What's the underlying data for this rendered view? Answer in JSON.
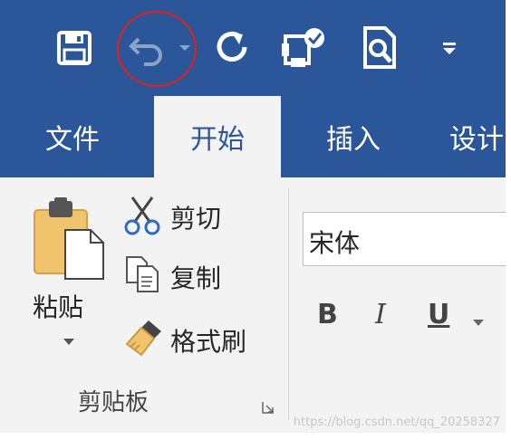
{
  "tabs": [
    {
      "label": "文件"
    },
    {
      "label": "开始"
    },
    {
      "label": "插入"
    },
    {
      "label": "设计"
    }
  ],
  "clipboard": {
    "paste_label": "粘贴",
    "cut_label": "剪切",
    "copy_label": "复制",
    "format_painter_label": "格式刷",
    "group_label": "剪贴板"
  },
  "font": {
    "current_font": "宋体",
    "bold_label": "B",
    "italic_label": "I",
    "underline_label": "U"
  },
  "watermark": "https://blog.csdn.net/qq_20258327",
  "colors": {
    "ribbon_blue": "#2b579a",
    "ribbon_bg": "#f3f3f3",
    "highlight_circle": "#e0201b"
  },
  "quick_access_icons": [
    "save-icon",
    "undo-icon",
    "redo-icon",
    "touch-mode-icon",
    "print-preview-icon",
    "customize-icon"
  ]
}
